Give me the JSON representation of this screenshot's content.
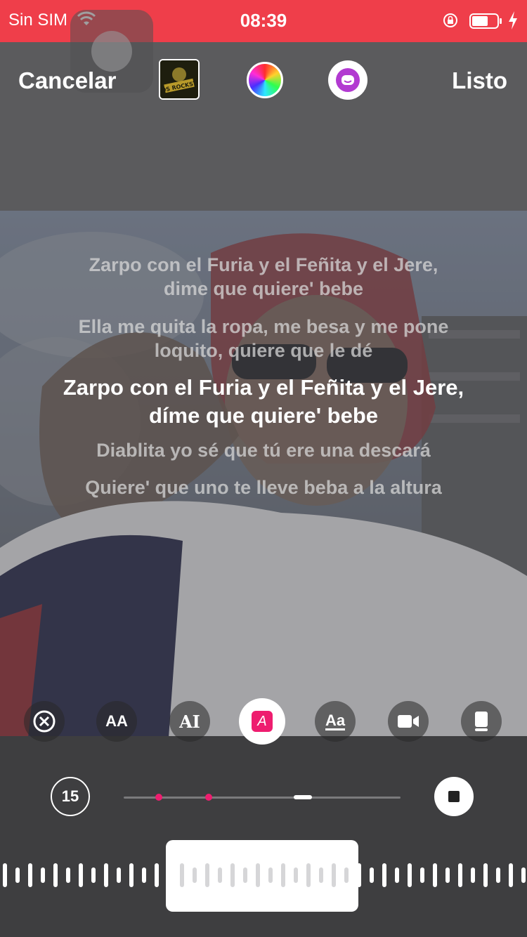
{
  "status_bar": {
    "carrier": "Sin SIM",
    "time": "08:39"
  },
  "toolbar": {
    "cancel_label": "Cancelar",
    "done_label": "Listo"
  },
  "album": {
    "art_text": "LOS ROCKSTA"
  },
  "lyrics": [
    {
      "line1": "Zarpo con el Furia y el Feñita y el Jere,",
      "line2": "dime que quiere' bebe",
      "active": false
    },
    {
      "line1": "Ella me quita la ropa, me besa y me pone",
      "line2": "loquito, quiere que le dé",
      "active": false
    },
    {
      "line1": "Zarpo con el Furia y el Feñita y el Jere,",
      "line2": "díme que quiere' bebe",
      "active": true
    },
    {
      "line1": "Diablita yo sé que tú ere una descará",
      "line2": "",
      "active": false
    },
    {
      "line1": "Quiere' que uno te lleve beba a la altura",
      "line2": "",
      "active": false
    }
  ],
  "style_tools": [
    {
      "name": "remove-icon",
      "label": ""
    },
    {
      "name": "text-size-icon",
      "label": "AA"
    },
    {
      "name": "text-style-icon",
      "label": "AI"
    },
    {
      "name": "text-color-icon",
      "label": "A",
      "selected": true
    },
    {
      "name": "text-format-icon",
      "label": "Aa"
    },
    {
      "name": "video-icon",
      "label": ""
    },
    {
      "name": "device-icon",
      "label": ""
    }
  ],
  "player": {
    "rewind_seconds": "15",
    "markers": [
      0.12,
      0.3
    ],
    "playhead": 0.64
  },
  "colors": {
    "status_bar": "#ef3e4a",
    "accent": "#ee1d6f",
    "panel": "#3e3e40"
  }
}
